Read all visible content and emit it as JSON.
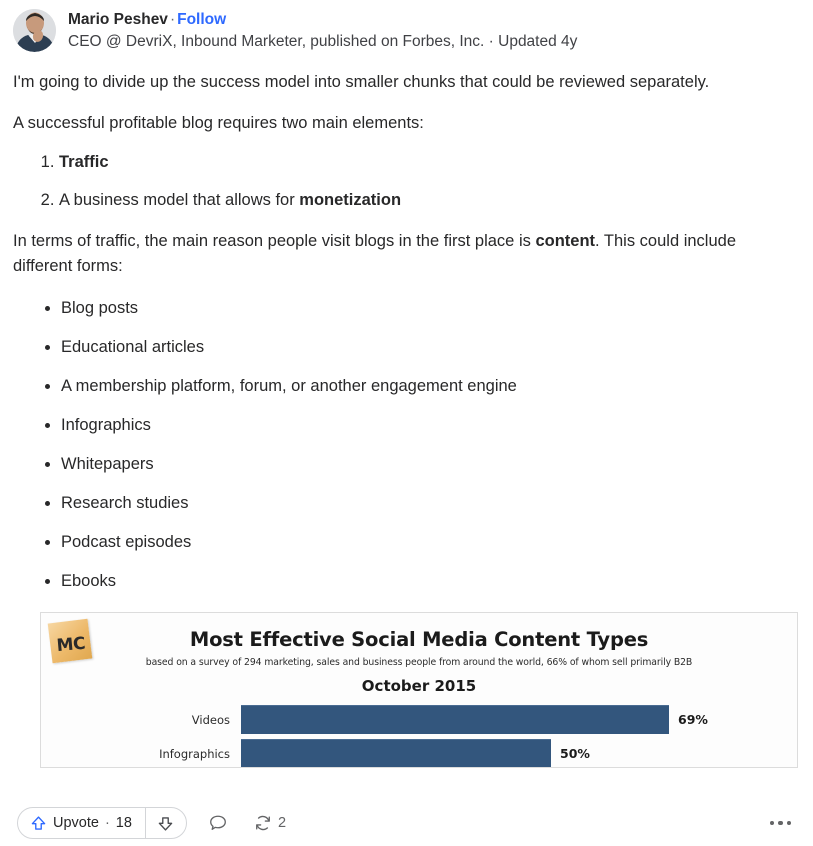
{
  "author": {
    "name": "Mario Peshev",
    "separator": "·",
    "follow_label": "Follow",
    "credential": "CEO @ DevriX, Inbound Marketer, published on Forbes, Inc. · Updated 4y",
    "avatar_icon": "user-avatar-photo"
  },
  "content": {
    "para1": "I'm going to divide up the success model into smaller chunks that could be reviewed separately.",
    "para2": "A successful profitable blog requires two main elements:",
    "numbered_list": [
      {
        "text_before": "",
        "bold": "Traffic",
        "text_after": ""
      },
      {
        "text_before": "A business model that allows for ",
        "bold": "monetization",
        "text_after": ""
      }
    ],
    "para3_before": "In terms of traffic, the main reason people visit blogs in the first place is ",
    "para3_bold": "content",
    "para3_after": ". This could include different forms:",
    "bulleted_list": [
      "Blog posts",
      "Educational articles",
      "A membership platform, forum, or another engagement engine",
      "Infographics",
      "Whitepapers",
      "Research studies",
      "Podcast episodes",
      "Ebooks"
    ]
  },
  "infographic": {
    "logo_text": "MC",
    "logo_icon": "sticky-note-mc-logo",
    "title": "Most Effective Social Media Content Types",
    "subtitle": "based on a survey of 294 marketing, sales and business people from around the world, 66% of whom sell primarily B2B",
    "period": "October 2015"
  },
  "chart_data": {
    "type": "bar",
    "orientation": "horizontal",
    "title": "Most Effective Social Media Content Types",
    "subtitle": "based on a survey of 294 marketing, sales and business people from around the world, 66% of whom sell primarily B2B",
    "period": "October 2015",
    "categories": [
      "Videos",
      "Infographics"
    ],
    "values": [
      69,
      50
    ],
    "value_labels": [
      "69%",
      "50%"
    ],
    "xlabel": "",
    "ylabel": "",
    "xlim": [
      0,
      80
    ],
    "grid": false,
    "legend": false,
    "bar_color": "#33567d",
    "note": "chart is cropped at the bottom of the visible viewport"
  },
  "actions": {
    "upvote_icon": "upvote-arrow-icon",
    "upvote_label": "Upvote",
    "separator": "·",
    "upvote_count": "18",
    "downvote_icon": "downvote-arrow-icon",
    "comment_icon": "comment-bubble-icon",
    "share_icon": "repost-share-icon",
    "share_count": "2",
    "more_icon": "more-options-icon"
  },
  "colors": {
    "link_blue": "#2e69ff",
    "upvote_blue": "#2e69ff",
    "bar_blue": "#33567d",
    "text": "#282829",
    "muted": "#636466"
  }
}
